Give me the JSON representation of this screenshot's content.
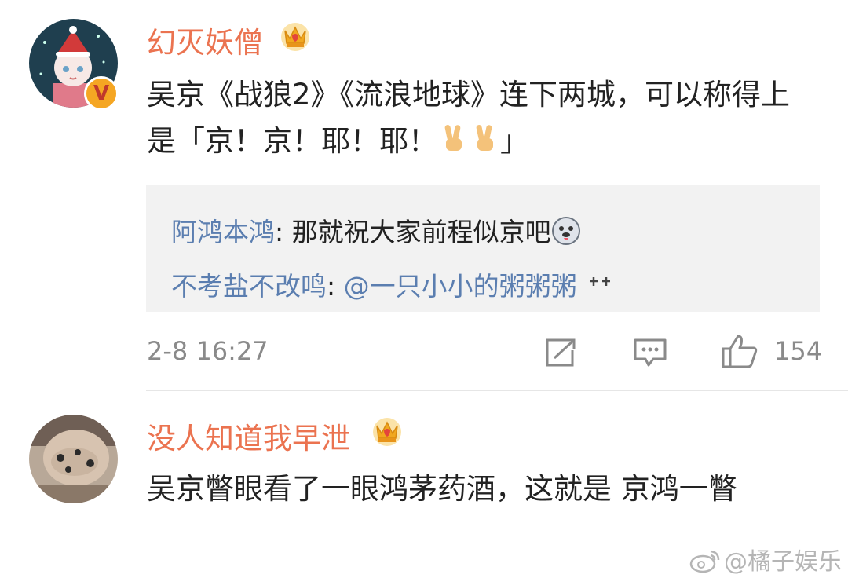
{
  "comments": [
    {
      "username": "幻灭妖僧",
      "text_before": "吴京《战狼2》《流浪地球》连下两城，可以称得上是「京！京！耶！耶！",
      "text_after": "」",
      "verified_badge": "V",
      "badge_icon": "crown-icon",
      "replies": [
        {
          "name": "阿鸿本鸿",
          "separator": ": ",
          "text": "那就祝大家前程似京吧"
        },
        {
          "name": "不考盐不改鸣",
          "separator": ": ",
          "mention": "@一只小小的粥粥粥"
        }
      ],
      "timestamp": "2-8 16:27",
      "like_count": "154"
    },
    {
      "username": "没人知道我早泄",
      "text": "吴京瞥眼看了一眼鸿茅药酒，这就是 京鸿一瞥",
      "badge_icon": "crown-icon"
    }
  ],
  "watermark": "@橘子娱乐",
  "colors": {
    "username": "#eb7350",
    "reply_name": "#5b7eb0",
    "meta": "#8a8a8a",
    "reply_bg": "#f2f2f2"
  }
}
